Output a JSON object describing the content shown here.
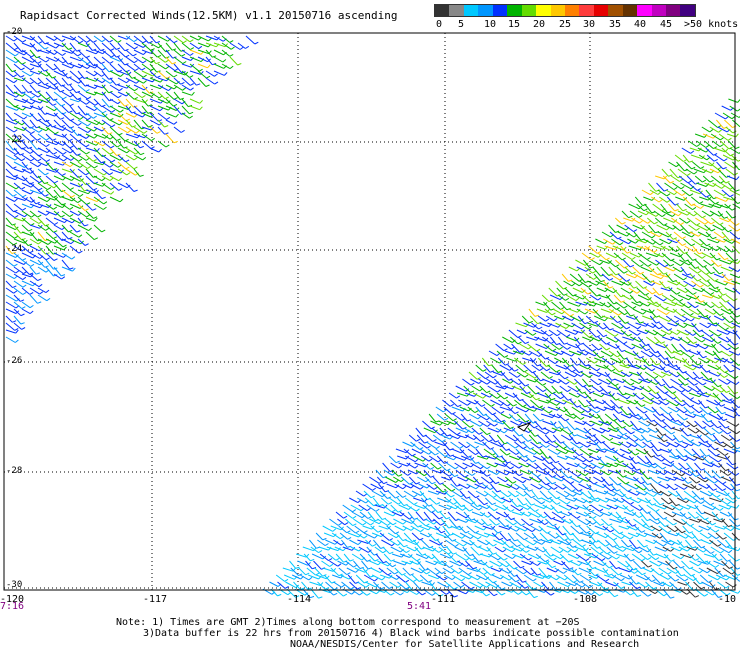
{
  "title": "Rapidsact Corrected Winds(12.5KM) v1.1 20150716 ascending",
  "legend": {
    "colors": [
      "#333333",
      "#888888",
      "#00c8ff",
      "#0096ff",
      "#0032ff",
      "#00b400",
      "#64dc00",
      "#ffff00",
      "#ffc800",
      "#ff8000",
      "#ff3c3c",
      "#e60000",
      "#a05000",
      "#643200",
      "#ff00ff",
      "#c000c0",
      "#800080",
      "#400080"
    ],
    "labels": [
      "0",
      "5",
      "10",
      "15",
      "20",
      "25",
      "30",
      "35",
      "40",
      "45",
      ">50 knots"
    ]
  },
  "axes": {
    "lat_labels": [
      "-20",
      "-22",
      "-24",
      "-26",
      "-28",
      "-30"
    ],
    "lon_labels": [
      "-120",
      "-117",
      "-114",
      "-111",
      "-108",
      "-10"
    ]
  },
  "times": [
    "7:16",
    "5:41"
  ],
  "notes": [
    "Note: 1) Times are GMT 2)Times along bottom correspond to measurement at −20S",
    "3)Data buffer is 22 hrs from 20150716 4) Black wind barbs indicate possible contamination",
    "NOAA/NESDIS/Center for Satellite Applications and Research"
  ]
}
